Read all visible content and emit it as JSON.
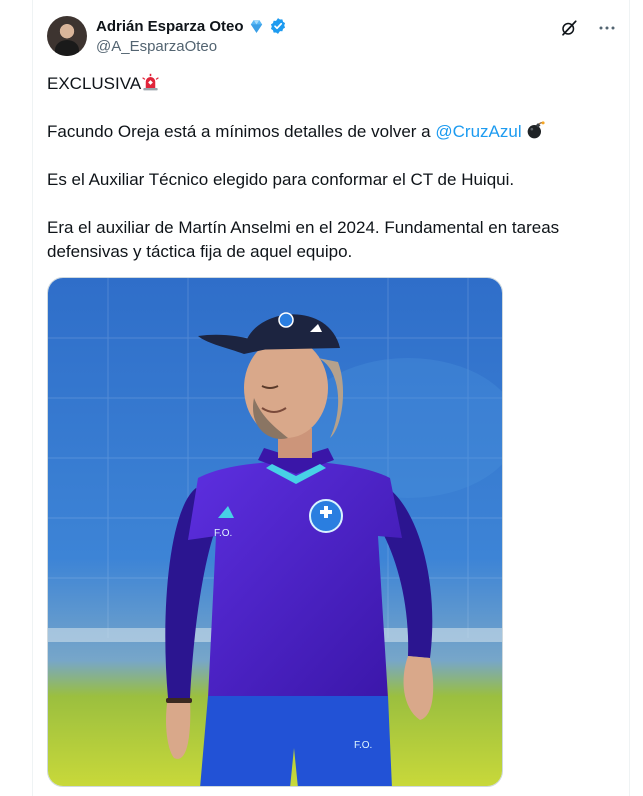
{
  "author": {
    "name": "Adrián Esparza Oteo",
    "handle": "@A_EsparzaOteo"
  },
  "icons": {
    "diamond": "diamond-icon",
    "verified": "verified-badge-icon",
    "grok": "grok-icon",
    "more": "more-options-icon",
    "siren": "siren-emoji",
    "bomb": "bomb-emoji"
  },
  "tweet": {
    "line1": "EXCLUSIVA",
    "line2_prefix": "Facundo Oreja está a mínimos detalles de volver a ",
    "line2_mention": "@CruzAzul",
    "line3": "Es el Auxiliar Técnico elegido para conformar el CT de Huiqui.",
    "line4": "Era el auxiliar de Martín Anselmi en el 2024. Fundamental en tareas defensivas y táctica fija de aquel equipo."
  },
  "colors": {
    "accent": "#1d9bf0",
    "text": "#0f1419",
    "secondary": "#536471",
    "shirt": "#4b1fc0"
  }
}
